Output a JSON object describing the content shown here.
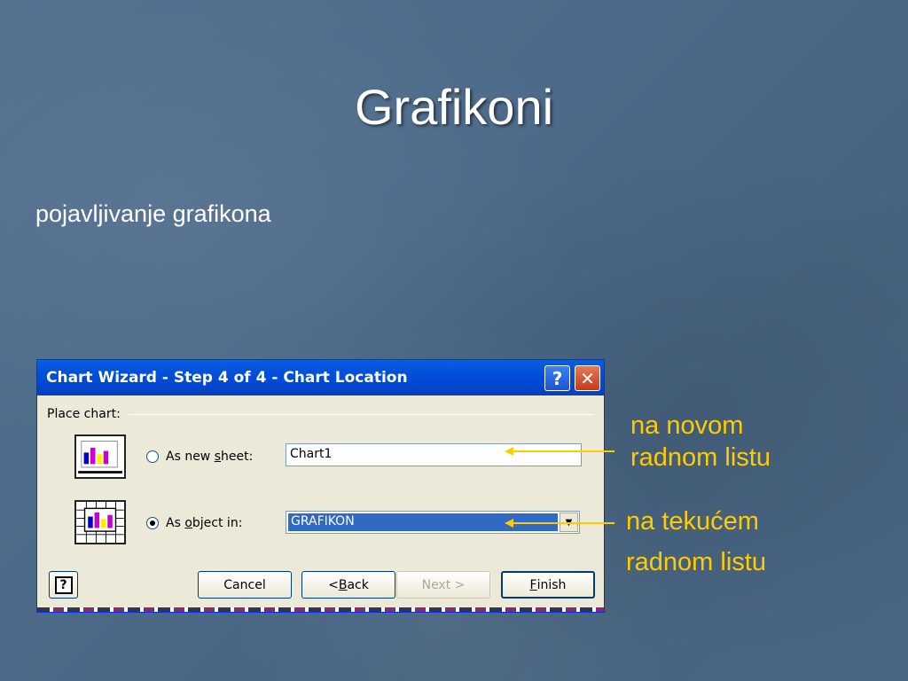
{
  "slide": {
    "title": "Grafikoni",
    "subtitle": "pojavljivanje grafikona"
  },
  "annotations": {
    "new_sheet_line1": "na novom",
    "new_sheet_line2": "radnom listu",
    "current_sheet_line1": "na tekućem",
    "current_sheet_line2": "radnom listu",
    "color": "#ffcc00"
  },
  "dialog": {
    "title": "Chart Wizard - Step 4 of 4 - Chart Location",
    "help_glyph": "?",
    "close_glyph": "✕",
    "group_label": "Place chart:",
    "option_new_sheet": {
      "label_pre": "As new ",
      "label_key": "s",
      "label_post": "heet:",
      "checked": false,
      "value": "Chart1"
    },
    "option_object_in": {
      "label_pre": "As ",
      "label_key": "o",
      "label_post": "bject in:",
      "checked": true,
      "value": "GRAFIKON"
    },
    "buttons": {
      "help_glyph": "?",
      "cancel": "Cancel",
      "back_pre": "< ",
      "back_key": "B",
      "back_post": "ack",
      "next": "Next >",
      "finish_key": "F",
      "finish_post": "inish"
    }
  }
}
